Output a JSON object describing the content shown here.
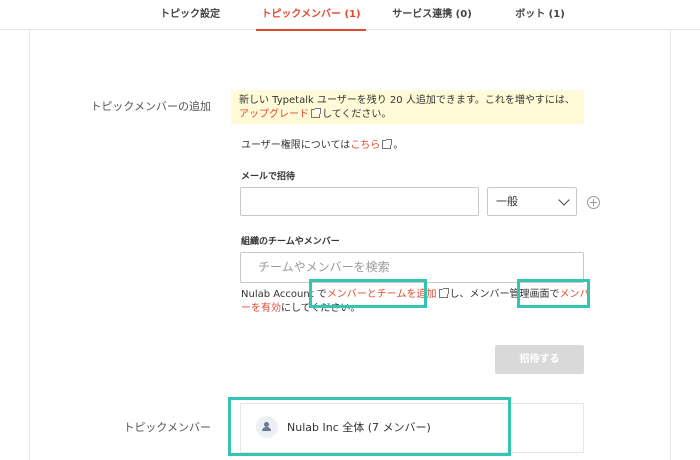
{
  "tabs": [
    {
      "label": "トピック設定"
    },
    {
      "label": "トピックメンバー (1)",
      "active": true
    },
    {
      "label": "サービス連携 (0)"
    },
    {
      "label": "ボット (1)"
    }
  ],
  "add_section": {
    "label": "トピックメンバーの追加",
    "notice_text": "新しい Typetalk ユーザーを残り 20 人追加できます。これを増やすには、",
    "notice_link": "アップグレード",
    "notice_suffix": "してください。",
    "permission_text": "ユーザー権限については",
    "permission_link": "こちら",
    "permission_suffix": "。",
    "email_label": "メールで招待",
    "email_value": "",
    "role_value": "一般",
    "org_label": "組織のチームやメンバー",
    "search_placeholder": "チームやメンバーを検索",
    "help_prefix": "Nulab Account で",
    "help_link1": "メンバーとチームを追加",
    "help_middle": "し、メンバー管理画面で",
    "help_link2": "メンバーを有効",
    "help_suffix": "にしてください。",
    "invite_button": "招待する"
  },
  "members_section": {
    "label": "トピックメンバー",
    "members": [
      {
        "name": "Nulab Inc 全体 (7 メンバー)",
        "icon": "team-icon"
      }
    ]
  },
  "colors": {
    "accent": "#e24a2e",
    "highlight": "#35c4b0",
    "notice_bg": "#fffbd8"
  }
}
